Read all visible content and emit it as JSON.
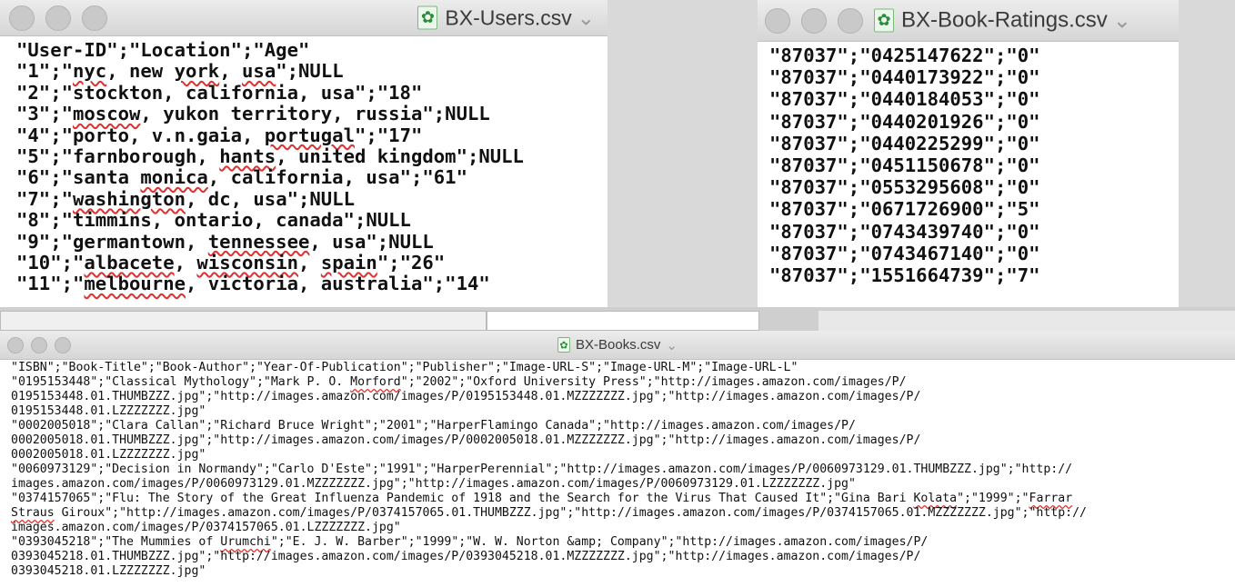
{
  "users_window": {
    "title": "BX-Users.csv",
    "lines": [
      [
        {
          "t": "\"User-ID\";\"Location\";\"Age\""
        }
      ],
      [
        {
          "t": "\"1\";\""
        },
        {
          "t": "nyc",
          "sq": true
        },
        {
          "t": ", new "
        },
        {
          "t": "york",
          "sq": true
        },
        {
          "t": ", "
        },
        {
          "t": "usa",
          "sq": true
        },
        {
          "t": "\";NULL"
        }
      ],
      [
        {
          "t": "\"2\";\"stockton, california, usa\";\"18\""
        }
      ],
      [
        {
          "t": "\"3\";\""
        },
        {
          "t": "moscow",
          "sq": true
        },
        {
          "t": ", yukon territory, russia\";NULL"
        }
      ],
      [
        {
          "t": "\"4\";\"porto, v.n.gaia, "
        },
        {
          "t": "portugal",
          "sq": true
        },
        {
          "t": "\";\"17\""
        }
      ],
      [
        {
          "t": "\"5\";\"farnborough, "
        },
        {
          "t": "hants",
          "sq": true
        },
        {
          "t": ", united kingdom\";NULL"
        }
      ],
      [
        {
          "t": "\"6\";\"santa "
        },
        {
          "t": "monica",
          "sq": true
        },
        {
          "t": ", california, usa\";\"61\""
        }
      ],
      [
        {
          "t": "\"7\";\""
        },
        {
          "t": "washington",
          "sq": true
        },
        {
          "t": ", dc, usa\";NULL"
        }
      ],
      [
        {
          "t": "\"8\";\"timmins, ontario, canada\";NULL"
        }
      ],
      [
        {
          "t": "\"9\";\"germantown, "
        },
        {
          "t": "tennessee",
          "sq": true
        },
        {
          "t": ", usa\";NULL"
        }
      ],
      [
        {
          "t": "\"10\";\""
        },
        {
          "t": "albacete",
          "sq": true
        },
        {
          "t": ", "
        },
        {
          "t": "wisconsin",
          "sq": true
        },
        {
          "t": ", "
        },
        {
          "t": "spain",
          "sq": true
        },
        {
          "t": "\";\"26\""
        }
      ],
      [
        {
          "t": "\"11\";\""
        },
        {
          "t": "melbourne",
          "sq": true
        },
        {
          "t": ", victoria, australia\";\"14\""
        }
      ]
    ]
  },
  "ratings_window": {
    "title": "BX-Book-Ratings.csv",
    "lines": [
      [
        {
          "t": "\"87037\";\"0425147622\";\"0\""
        }
      ],
      [
        {
          "t": "\"87037\";\"0440173922\";\"0\""
        }
      ],
      [
        {
          "t": "\"87037\";\"0440184053\";\"0\""
        }
      ],
      [
        {
          "t": "\"87037\";\"0440201926\";\"0\""
        }
      ],
      [
        {
          "t": "\"87037\";\"0440225299\";\"0\""
        }
      ],
      [
        {
          "t": "\"87037\";\"0451150678\";\"0\""
        }
      ],
      [
        {
          "t": "\"87037\";\"0553295608\";\"0\""
        }
      ],
      [
        {
          "t": "\"87037\";\"0671726900\";\"5\""
        }
      ],
      [
        {
          "t": "\"87037\";\"0743439740\";\"0\""
        }
      ],
      [
        {
          "t": "\"87037\";\"0743467140\";\"0\""
        }
      ],
      [
        {
          "t": "\"87037\";\"1551664739\";\"7\""
        }
      ]
    ]
  },
  "books_window": {
    "title": "BX-Books.csv",
    "lines": [
      [
        {
          "t": "\"ISBN\";\"Book-Title\";\"Book-Author\";\"Year-Of-Publication\";\"Publisher\";\"Image-URL-S\";\"Image-URL-M\";\"Image-URL-L\""
        }
      ],
      [
        {
          "t": "\"0195153448\";\"Classical Mythology\";\"Mark P. O. "
        },
        {
          "t": "Morford",
          "sq": true
        },
        {
          "t": "\";\"2002\";\"Oxford University Press\";\"http://images.amazon.com/images/P/"
        }
      ],
      [
        {
          "t": "0195153448.01.THUMBZZZ.jpg\";\"http://images.amazon.com/images/P/0195153448.01.MZZZZZZZ.jpg\";\"http://images.amazon.com/images/P/"
        }
      ],
      [
        {
          "t": "0195153448.01.LZZZZZZZ.jpg\""
        }
      ],
      [
        {
          "t": "\"0002005018\";\"Clara Callan\";\"Richard Bruce Wright\";\"2001\";\"HarperFlamingo Canada\";\"http://images.amazon.com/images/P/"
        }
      ],
      [
        {
          "t": "0002005018.01.THUMBZZZ.jpg\";\"http://images.amazon.com/images/P/0002005018.01.MZZZZZZZ.jpg\";\"http://images.amazon.com/images/P/"
        }
      ],
      [
        {
          "t": "0002005018.01.LZZZZZZZ.jpg\""
        }
      ],
      [
        {
          "t": "\"0060973129\";\"Decision in Normandy\";\"Carlo D'Este\";\"1991\";\"HarperPerennial\";\"http://images.amazon.com/images/P/0060973129.01.THUMBZZZ.jpg\";\"http://"
        }
      ],
      [
        {
          "t": "images.amazon.com/images/P/0060973129.01.MZZZZZZZ.jpg\";\"http://images.amazon.com/images/P/0060973129.01.LZZZZZZZ.jpg\""
        }
      ],
      [
        {
          "t": "\"0374157065\";\"Flu: The Story of the Great Influenza Pandemic of 1918 and the Search for the Virus That Caused It\";\"Gina Bari "
        },
        {
          "t": "Kolata",
          "sq": true
        },
        {
          "t": "\";\"1999\";\""
        },
        {
          "t": "Farrar",
          "sq": true
        }
      ],
      [
        {
          "t": "Straus",
          "sq": true
        },
        {
          "t": " Giroux\";\"http://images.amazon.com/images/P/0374157065.01.THUMBZZZ.jpg\";\"http://images.amazon.com/images/P/0374157065.01.MZZZZZZZ.jpg\";\"http://"
        }
      ],
      [
        {
          "t": "images.amazon.com/images/P/0374157065.01.LZZZZZZZ.jpg\""
        }
      ],
      [
        {
          "t": "\"0393045218\";\"The Mummies of "
        },
        {
          "t": "Urumchi",
          "sq": true
        },
        {
          "t": "\";\"E. J. W. Barber\";\"1999\";\"W. W. Norton &amp; Company\";\"http://images.amazon.com/images/P/"
        }
      ],
      [
        {
          "t": "0393045218.01.THUMBZZZ.jpg\";\"http://images.amazon.com/images/P/0393045218.01.MZZZZZZZ.jpg\";\"http://images.amazon.com/images/P/"
        }
      ],
      [
        {
          "t": "0393045218.01.LZZZZZZZ.jpg\""
        }
      ]
    ]
  },
  "icons": {
    "window_controls": [
      "close-button",
      "minimize-button",
      "zoom-button"
    ],
    "file_icon": "csv-document-icon",
    "title_menu": "chevron-down-icon"
  },
  "colors": {
    "spellcheck_underline": "#dd3333",
    "file_icon_green": "#2e8b3d"
  }
}
